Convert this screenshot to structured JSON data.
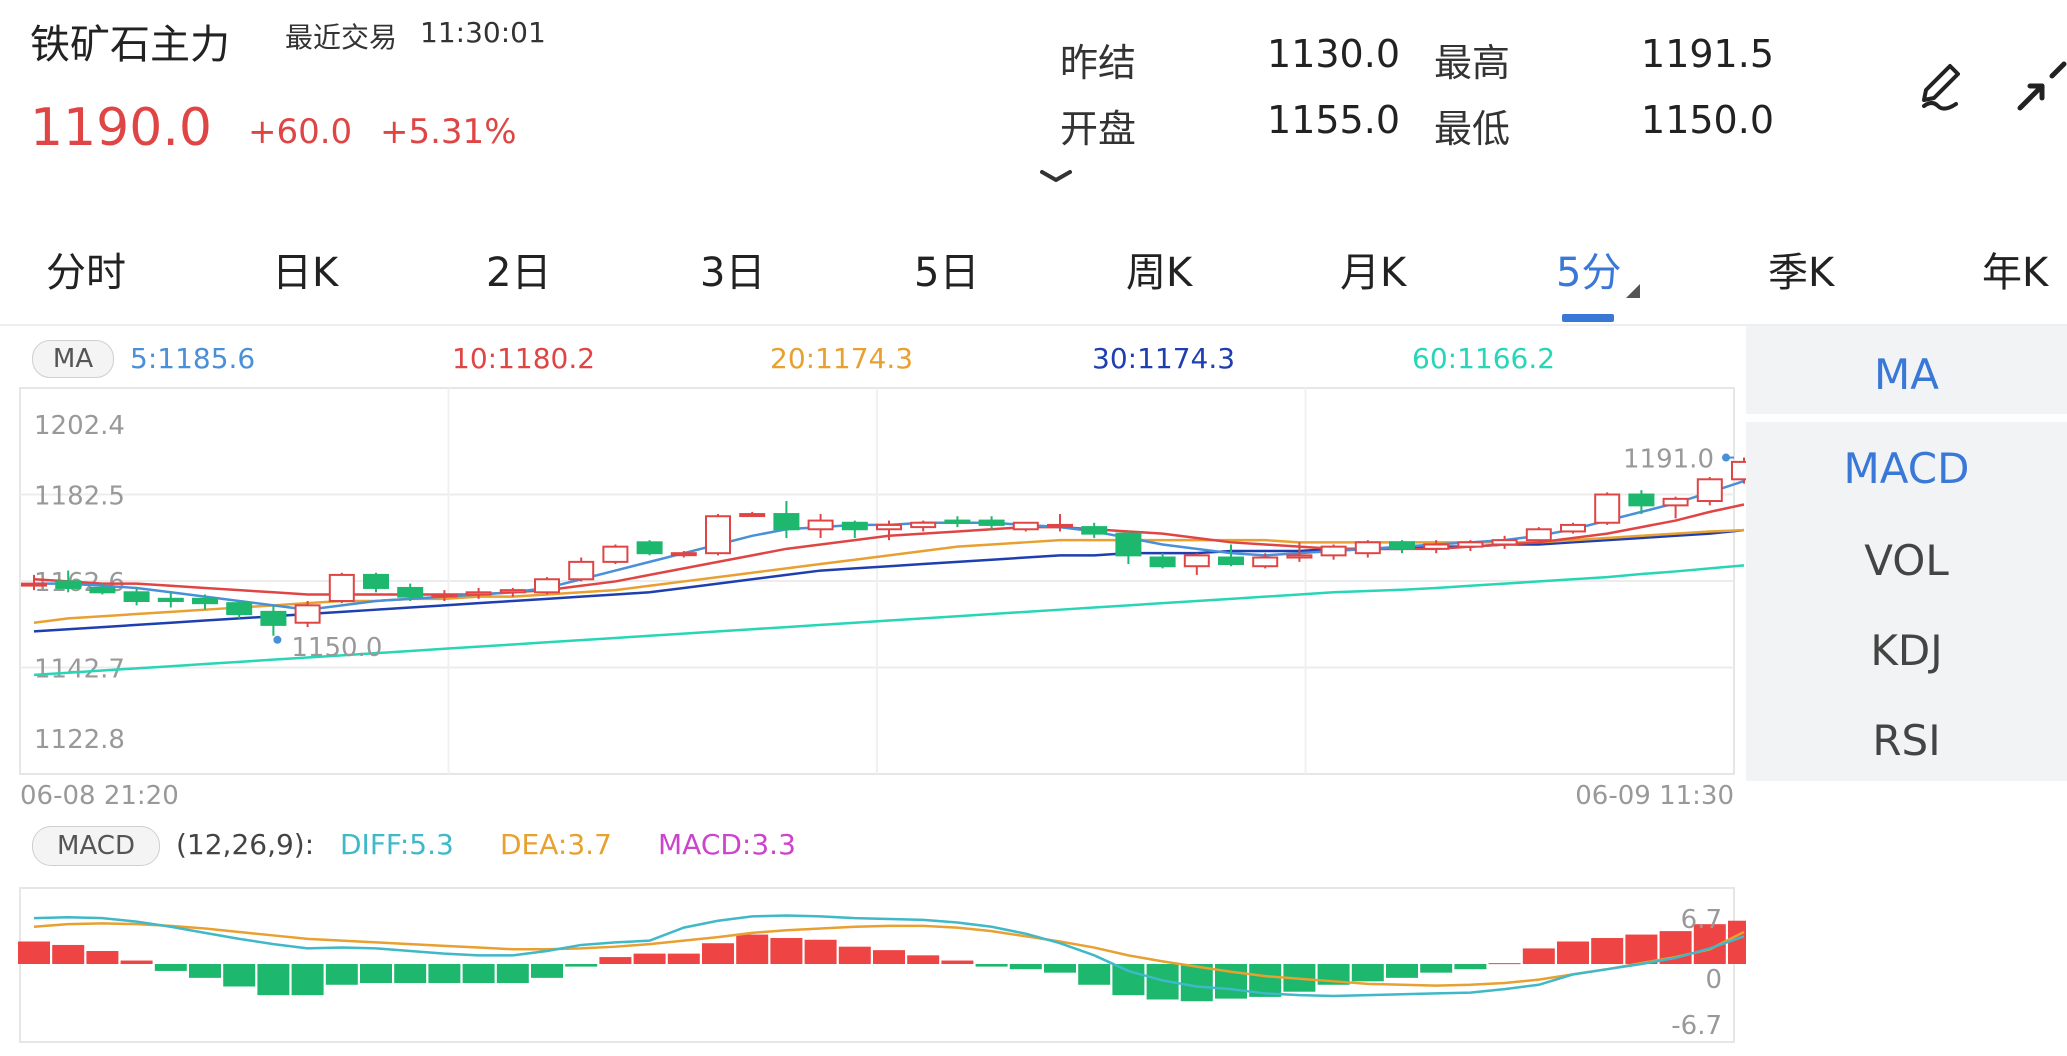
{
  "header": {
    "title": "铁矿石主力",
    "last_trade_label": "最近交易",
    "last_trade_time": "11:30:01",
    "price": "1190.0",
    "change": "+60.0",
    "change_pct": "+5.31%"
  },
  "stats": {
    "prev_settle_label": "昨结",
    "prev_settle": "1130.0",
    "high_label": "最高",
    "high": "1191.5",
    "open_label": "开盘",
    "open": "1155.0",
    "low_label": "最低",
    "low": "1150.0"
  },
  "tabs": [
    "分时",
    "日K",
    "2日",
    "3日",
    "5日",
    "周K",
    "月K",
    "5分",
    "季K",
    "年K"
  ],
  "active_tab": "5分",
  "side_panel": {
    "items": [
      "MA",
      "MACD",
      "VOL",
      "KDJ",
      "RSI"
    ],
    "selected_top": "MA",
    "active_indicator": "MACD"
  },
  "ma_legend": {
    "badge": "MA",
    "ma5": "5:1185.6",
    "ma10": "10:1180.2",
    "ma20": "20:1174.3",
    "ma30": "30:1174.3",
    "ma60": "60:1166.2"
  },
  "macd_legend": {
    "badge": "MACD",
    "params": "(12,26,9):",
    "diff": "DIFF:5.3",
    "dea": "DEA:3.7",
    "macd": "MACD:3.3"
  },
  "colors": {
    "up": "#e04545",
    "down": "#1db86e",
    "ma5": "#4a90d9",
    "ma10": "#e04545",
    "ma20": "#e8a030",
    "ma30": "#1f3fb0",
    "ma60": "#26d6b6",
    "diff": "#3fb8c8",
    "dea": "#e8a030",
    "macd": "#cc44cc",
    "accent": "#3a78d8"
  },
  "chart_data": [
    {
      "type": "candlestick",
      "ylim": [
        1122.8,
        1202.4
      ],
      "y_ticks": [
        "1202.4",
        "1182.5",
        "1162.6",
        "1142.7",
        "1122.8"
      ],
      "x_start_label": "06-08 21:20",
      "x_end_label": "06-09 11:30",
      "high_marker": "1191.0",
      "low_marker": "1150.0",
      "candles": [
        {
          "o": 1162.0,
          "h": 1164.0,
          "l": 1160.5,
          "c": 1162.0
        },
        {
          "o": 1162.5,
          "h": 1165.0,
          "l": 1160.0,
          "c": 1161.0
        },
        {
          "o": 1161.0,
          "h": 1162.0,
          "l": 1159.5,
          "c": 1160.0
        },
        {
          "o": 1160.0,
          "h": 1161.0,
          "l": 1157.0,
          "c": 1158.0
        },
        {
          "o": 1158.5,
          "h": 1160.0,
          "l": 1156.5,
          "c": 1158.0
        },
        {
          "o": 1158.5,
          "h": 1159.5,
          "l": 1156.0,
          "c": 1157.5
        },
        {
          "o": 1157.5,
          "h": 1158.0,
          "l": 1154.0,
          "c": 1155.0
        },
        {
          "o": 1155.5,
          "h": 1157.0,
          "l": 1150.0,
          "c": 1152.5
        },
        {
          "o": 1153.0,
          "h": 1158.0,
          "l": 1152.0,
          "c": 1157.0
        },
        {
          "o": 1158.0,
          "h": 1164.5,
          "l": 1157.5,
          "c": 1164.0
        },
        {
          "o": 1164.0,
          "h": 1164.5,
          "l": 1160.0,
          "c": 1161.0
        },
        {
          "o": 1161.0,
          "h": 1162.0,
          "l": 1158.0,
          "c": 1159.0
        },
        {
          "o": 1159.5,
          "h": 1160.5,
          "l": 1158.0,
          "c": 1159.5
        },
        {
          "o": 1159.5,
          "h": 1161.0,
          "l": 1158.5,
          "c": 1160.0
        },
        {
          "o": 1160.0,
          "h": 1161.0,
          "l": 1159.0,
          "c": 1160.5
        },
        {
          "o": 1160.0,
          "h": 1163.5,
          "l": 1159.5,
          "c": 1163.0
        },
        {
          "o": 1163.0,
          "h": 1168.0,
          "l": 1162.5,
          "c": 1167.0
        },
        {
          "o": 1167.0,
          "h": 1171.0,
          "l": 1166.5,
          "c": 1170.5
        },
        {
          "o": 1171.5,
          "h": 1172.0,
          "l": 1168.5,
          "c": 1169.0
        },
        {
          "o": 1169.0,
          "h": 1169.5,
          "l": 1168.0,
          "c": 1169.0
        },
        {
          "o": 1169.0,
          "h": 1178.0,
          "l": 1168.5,
          "c": 1177.5
        },
        {
          "o": 1178.0,
          "h": 1178.5,
          "l": 1177.5,
          "c": 1178.0
        },
        {
          "o": 1178.0,
          "h": 1181.0,
          "l": 1172.5,
          "c": 1174.5
        },
        {
          "o": 1174.5,
          "h": 1178.0,
          "l": 1172.5,
          "c": 1176.5
        },
        {
          "o": 1176.0,
          "h": 1176.5,
          "l": 1172.5,
          "c": 1174.5
        },
        {
          "o": 1174.5,
          "h": 1176.5,
          "l": 1172.0,
          "c": 1175.5
        },
        {
          "o": 1175.0,
          "h": 1176.5,
          "l": 1174.0,
          "c": 1176.0
        },
        {
          "o": 1176.5,
          "h": 1177.5,
          "l": 1175.0,
          "c": 1176.0
        },
        {
          "o": 1176.5,
          "h": 1177.5,
          "l": 1174.5,
          "c": 1175.5
        },
        {
          "o": 1174.5,
          "h": 1176.0,
          "l": 1174.0,
          "c": 1176.0
        },
        {
          "o": 1175.5,
          "h": 1178.0,
          "l": 1174.0,
          "c": 1175.5
        },
        {
          "o": 1175.0,
          "h": 1176.0,
          "l": 1172.5,
          "c": 1173.5
        },
        {
          "o": 1173.5,
          "h": 1174.0,
          "l": 1166.5,
          "c": 1168.5
        },
        {
          "o": 1168.0,
          "h": 1169.0,
          "l": 1165.5,
          "c": 1166.0
        },
        {
          "o": 1166.0,
          "h": 1169.0,
          "l": 1164.0,
          "c": 1168.5
        },
        {
          "o": 1168.0,
          "h": 1171.0,
          "l": 1166.0,
          "c": 1166.5
        },
        {
          "o": 1166.0,
          "h": 1169.0,
          "l": 1165.5,
          "c": 1168.0
        },
        {
          "o": 1168.0,
          "h": 1171.5,
          "l": 1167.0,
          "c": 1168.5
        },
        {
          "o": 1168.5,
          "h": 1171.0,
          "l": 1167.5,
          "c": 1170.5
        },
        {
          "o": 1169.0,
          "h": 1172.0,
          "l": 1168.0,
          "c": 1171.5
        },
        {
          "o": 1171.5,
          "h": 1172.0,
          "l": 1169.0,
          "c": 1170.0
        },
        {
          "o": 1170.0,
          "h": 1172.0,
          "l": 1169.0,
          "c": 1171.0
        },
        {
          "o": 1170.5,
          "h": 1172.0,
          "l": 1169.5,
          "c": 1171.5
        },
        {
          "o": 1171.0,
          "h": 1173.0,
          "l": 1170.0,
          "c": 1172.0
        },
        {
          "o": 1172.0,
          "h": 1175.0,
          "l": 1171.5,
          "c": 1174.5
        },
        {
          "o": 1174.0,
          "h": 1176.0,
          "l": 1173.5,
          "c": 1175.5
        },
        {
          "o": 1176.0,
          "h": 1183.0,
          "l": 1175.5,
          "c": 1182.5
        },
        {
          "o": 1182.5,
          "h": 1183.5,
          "l": 1178.0,
          "c": 1180.0
        },
        {
          "o": 1180.0,
          "h": 1182.0,
          "l": 1177.0,
          "c": 1181.5
        },
        {
          "o": 1181.0,
          "h": 1186.5,
          "l": 1180.0,
          "c": 1186.0
        },
        {
          "o": 1186.0,
          "h": 1191.0,
          "l": 1185.0,
          "c": 1190.0
        }
      ],
      "ma5": [
        1162,
        1162,
        1161.5,
        1161,
        1160,
        1159,
        1158,
        1157,
        1156,
        1157,
        1158,
        1158.5,
        1159,
        1159.5,
        1160,
        1161,
        1163,
        1165,
        1167,
        1169,
        1171,
        1173,
        1174.5,
        1175,
        1175.5,
        1175.5,
        1176,
        1176,
        1176,
        1175.5,
        1175,
        1174,
        1172.5,
        1171,
        1170,
        1169,
        1168.5,
        1169,
        1169.5,
        1170,
        1170.5,
        1171,
        1171.5,
        1172,
        1173,
        1174.5,
        1176.5,
        1178.5,
        1180.5,
        1183,
        1185.6
      ],
      "ma10": [
        1163,
        1162.5,
        1162,
        1162,
        1161.5,
        1161,
        1160.5,
        1160,
        1159.5,
        1159.5,
        1159.5,
        1159.5,
        1159.5,
        1159.5,
        1160,
        1160.5,
        1161.5,
        1162.5,
        1164,
        1165.5,
        1167,
        1168.5,
        1170,
        1171,
        1172,
        1173,
        1173.5,
        1174,
        1174.5,
        1175,
        1175,
        1174.5,
        1174,
        1173.5,
        1172.5,
        1171.5,
        1171,
        1170.5,
        1170,
        1170,
        1170,
        1170,
        1170.5,
        1171,
        1171.5,
        1172.5,
        1173.5,
        1175,
        1176.5,
        1178.5,
        1180.2
      ],
      "ma20": [
        1153,
        1154,
        1154.5,
        1155,
        1155.5,
        1156,
        1156.5,
        1157,
        1157.5,
        1158,
        1158,
        1158.5,
        1158.5,
        1159,
        1159,
        1159.5,
        1160,
        1160.5,
        1161.5,
        1162.5,
        1163.5,
        1164.5,
        1165.5,
        1166.5,
        1167.5,
        1168.5,
        1169.5,
        1170.5,
        1171,
        1171.5,
        1172,
        1172,
        1172,
        1172,
        1172,
        1172,
        1172,
        1171.5,
        1171.5,
        1171.5,
        1171.5,
        1171.5,
        1171.5,
        1171.5,
        1171.5,
        1172,
        1172.5,
        1173,
        1173.5,
        1174,
        1174.3
      ],
      "ma30": [
        1151,
        1151.5,
        1152,
        1152.5,
        1153,
        1153.5,
        1154,
        1154.5,
        1155,
        1155.5,
        1156,
        1156.5,
        1157,
        1157.5,
        1158,
        1158.5,
        1159,
        1159.5,
        1160,
        1161,
        1162,
        1163,
        1164,
        1165,
        1165.5,
        1166,
        1166.5,
        1167,
        1167.5,
        1168,
        1168.5,
        1168.5,
        1169,
        1169,
        1169,
        1169.5,
        1169.5,
        1169.5,
        1170,
        1170,
        1170,
        1170.5,
        1170.5,
        1171,
        1171,
        1171.5,
        1172,
        1172.5,
        1173,
        1173.5,
        1174.3
      ],
      "ma60": [
        1141,
        1141.5,
        1142,
        1142.5,
        1143,
        1143.5,
        1144,
        1144.5,
        1145,
        1145.5,
        1146,
        1146.5,
        1147,
        1147.5,
        1148,
        1148.5,
        1149,
        1149.5,
        1150,
        1150.5,
        1151,
        1151.5,
        1152,
        1152.5,
        1153,
        1153.5,
        1154,
        1154.5,
        1155,
        1155.5,
        1156,
        1156.5,
        1157,
        1157.5,
        1158,
        1158.5,
        1159,
        1159.5,
        1160,
        1160.3,
        1160.6,
        1161,
        1161.5,
        1162,
        1162.5,
        1163,
        1163.5,
        1164.2,
        1164.8,
        1165.5,
        1166.2
      ]
    },
    {
      "type": "bar",
      "title": "MACD",
      "ylim": [
        -6.7,
        6.7
      ],
      "y_ticks": [
        "6.7",
        "0",
        "-6.7"
      ],
      "histogram": [
        2.6,
        2.2,
        1.5,
        0.4,
        -0.8,
        -1.6,
        -2.6,
        -3.6,
        -3.6,
        -2.4,
        -2.2,
        -2.2,
        -2.2,
        -2.2,
        -2.2,
        -1.6,
        -0.3,
        0.8,
        1.2,
        1.2,
        2.4,
        3.4,
        3.0,
        2.8,
        2.0,
        1.6,
        1.0,
        0.4,
        -0.3,
        -0.6,
        -1.0,
        -2.4,
        -3.6,
        -4.1,
        -4.3,
        -4.0,
        -3.8,
        -3.2,
        -2.4,
        -2.0,
        -1.6,
        -1.0,
        -0.6,
        0.1,
        1.8,
        2.6,
        3.0,
        3.4,
        3.8,
        4.6,
        5.0
      ],
      "diff": [
        5.3,
        5.4,
        5.3,
        4.9,
        4.3,
        3.6,
        2.9,
        2.3,
        1.8,
        1.9,
        1.8,
        1.5,
        1.2,
        1.0,
        1.0,
        1.5,
        2.2,
        2.5,
        2.7,
        4.2,
        5.0,
        5.5,
        5.6,
        5.5,
        5.3,
        5.2,
        5.1,
        4.8,
        4.3,
        3.5,
        2.4,
        1.0,
        -0.8,
        -1.9,
        -2.6,
        -2.9,
        -3.4,
        -3.6,
        -3.7,
        -3.6,
        -3.5,
        -3.4,
        -3.3,
        -2.9,
        -2.4,
        -1.2,
        -0.6,
        0.0,
        0.7,
        1.8,
        3.2
      ],
      "dea": [
        4.3,
        4.6,
        4.7,
        4.6,
        4.4,
        4.1,
        3.7,
        3.3,
        2.9,
        2.7,
        2.5,
        2.3,
        2.1,
        1.9,
        1.7,
        1.7,
        1.8,
        2.0,
        2.3,
        2.7,
        3.1,
        3.6,
        3.9,
        4.1,
        4.3,
        4.4,
        4.4,
        4.2,
        3.8,
        3.2,
        2.6,
        1.9,
        1.0,
        0.3,
        -0.3,
        -0.9,
        -1.4,
        -1.7,
        -2.0,
        -2.3,
        -2.4,
        -2.5,
        -2.4,
        -2.2,
        -1.8,
        -1.2,
        -0.6,
        0.1,
        0.8,
        1.7,
        3.7
      ]
    }
  ]
}
